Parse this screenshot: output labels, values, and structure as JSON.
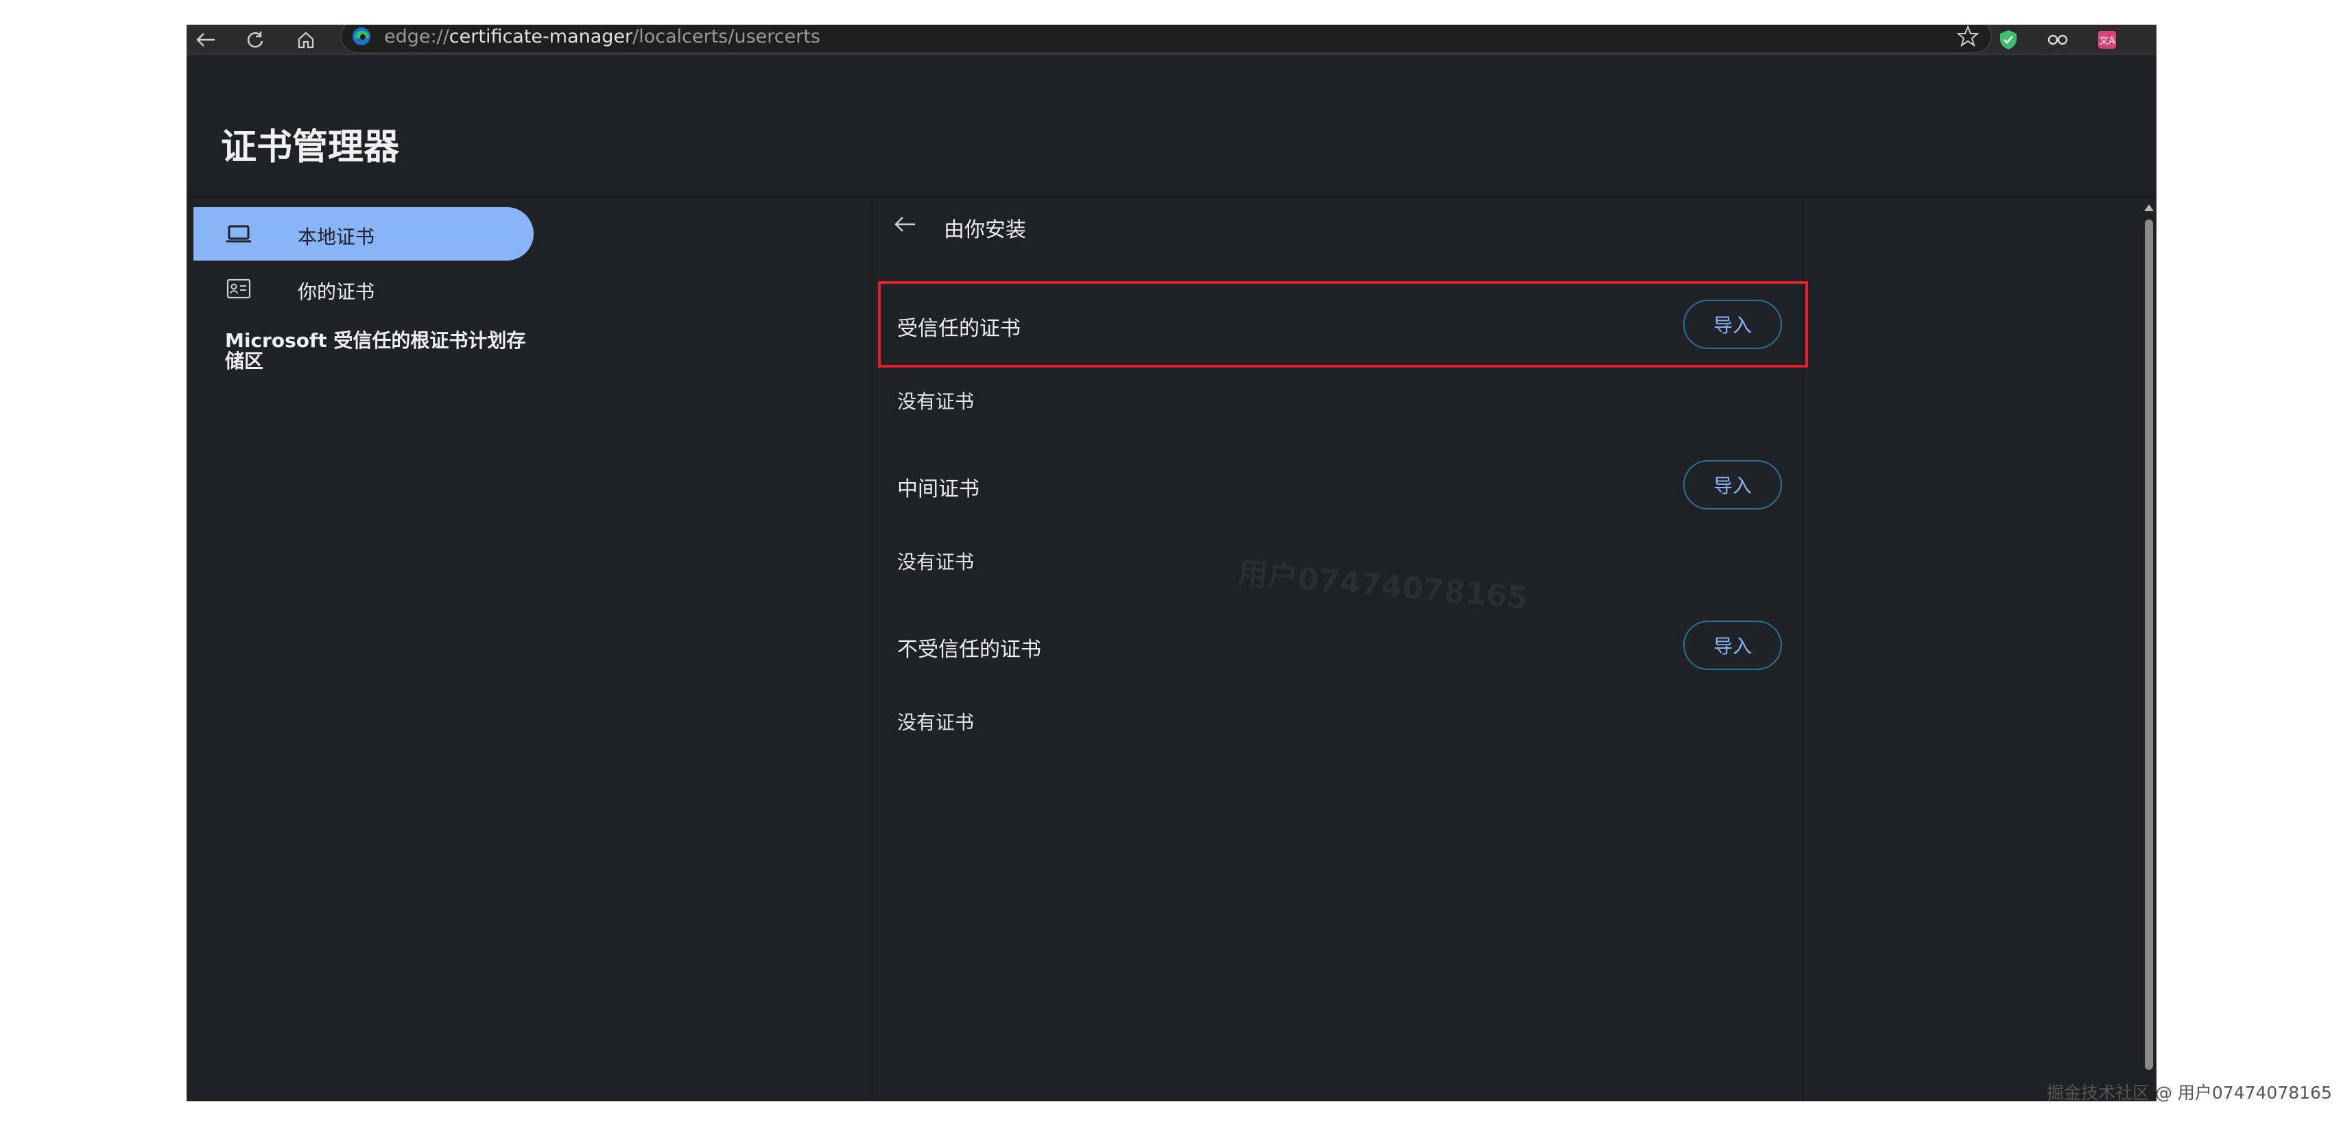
{
  "browser": {
    "url_prefix": "edge://",
    "url_host": "certificate-manager",
    "url_path": "/localcerts/usercerts",
    "more_label": "···"
  },
  "page": {
    "title": "证书管理器"
  },
  "sidebar": {
    "items": [
      {
        "label": "本地证书",
        "icon": "laptop-icon",
        "active": true
      },
      {
        "label": "你的证书",
        "icon": "id-card-icon",
        "active": false
      }
    ],
    "ms_store_label": "Microsoft 受信任的根证书计划存储区"
  },
  "main": {
    "back_title": "由你安装",
    "sections": [
      {
        "label": "受信任的证书",
        "button": "导入",
        "empty": "没有证书",
        "highlighted": true
      },
      {
        "label": "中间证书",
        "button": "导入",
        "empty": "没有证书",
        "highlighted": false
      },
      {
        "label": "不受信任的证书",
        "button": "导入",
        "empty": "没有证书",
        "highlighted": false
      }
    ]
  },
  "watermark": "用户07474078165",
  "credit": "掘金技术社区 @ 用户07474078165",
  "colors": {
    "accent": "#8ab4f8",
    "highlight_border": "#e0202a",
    "background": "#202124"
  }
}
